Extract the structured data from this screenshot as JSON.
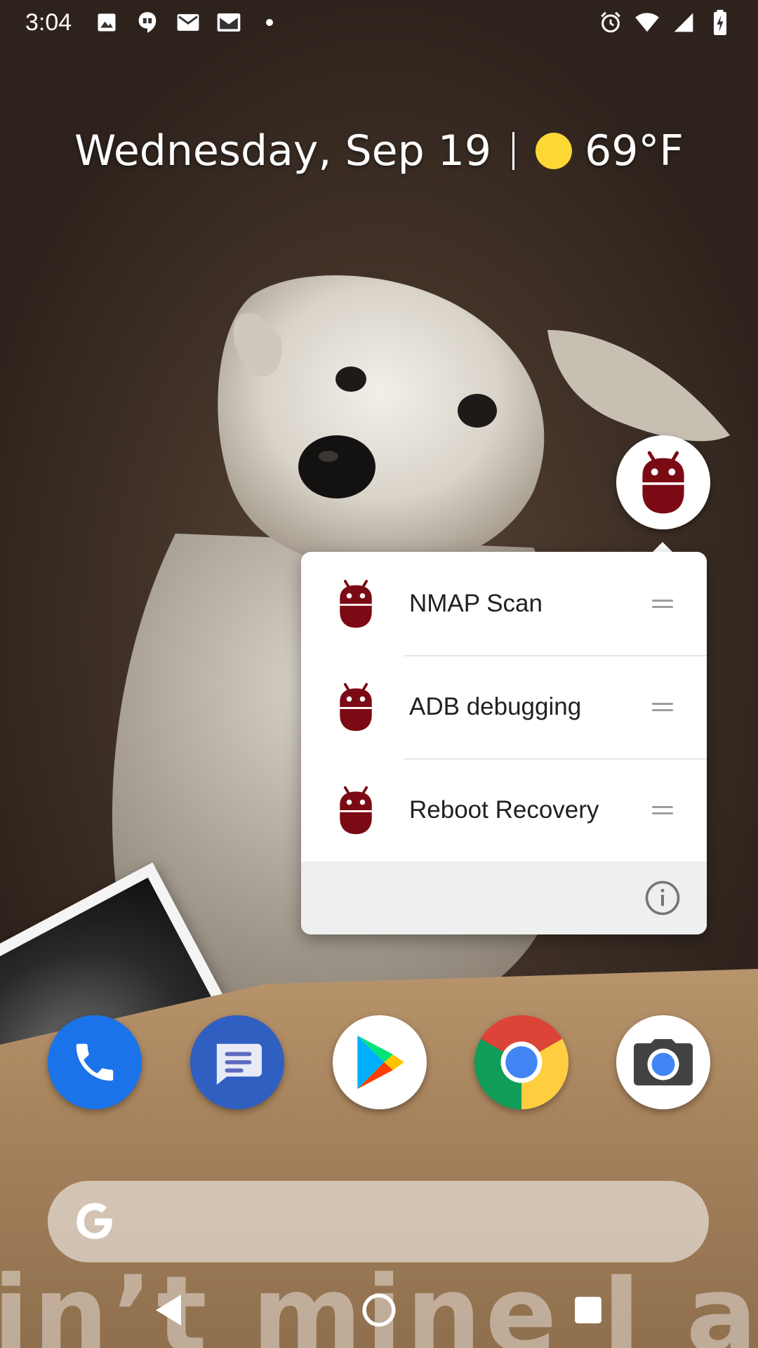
{
  "status_bar": {
    "time": "3:04",
    "left_icons": [
      "photo-notification-icon",
      "hangouts-icon",
      "gmail-icon",
      "inbox-icon",
      "more-dot-icon"
    ],
    "right_icons": [
      "alarm-icon",
      "wifi-icon",
      "cell-signal-icon",
      "battery-charging-icon"
    ]
  },
  "glance": {
    "date": "Wednesday, Sep 19",
    "temperature": "69°F",
    "weather_icon": "sun-icon"
  },
  "wallpaper": {
    "box_text": "in’t mine I awo"
  },
  "popup": {
    "shortcuts": [
      {
        "label": "NMAP Scan",
        "icon": "android-icon"
      },
      {
        "label": "ADB debugging",
        "icon": "android-icon"
      },
      {
        "label": "Reboot Recovery",
        "icon": "android-icon"
      }
    ],
    "footer_icon": "info-icon"
  },
  "dock": {
    "apps": [
      {
        "name": "Phone",
        "icon": "phone-icon"
      },
      {
        "name": "Messages",
        "icon": "messages-icon"
      },
      {
        "name": "Play Store",
        "icon": "play-store-icon"
      },
      {
        "name": "Chrome",
        "icon": "chrome-icon"
      },
      {
        "name": "Camera",
        "icon": "camera-icon"
      }
    ]
  },
  "search": {
    "icon": "google-g-icon"
  },
  "colors": {
    "android_icon": "#7b0a14",
    "phone_blue": "#1a73e8",
    "messages_blue": "#2f5fc1",
    "sun_yellow": "#fdd835"
  }
}
